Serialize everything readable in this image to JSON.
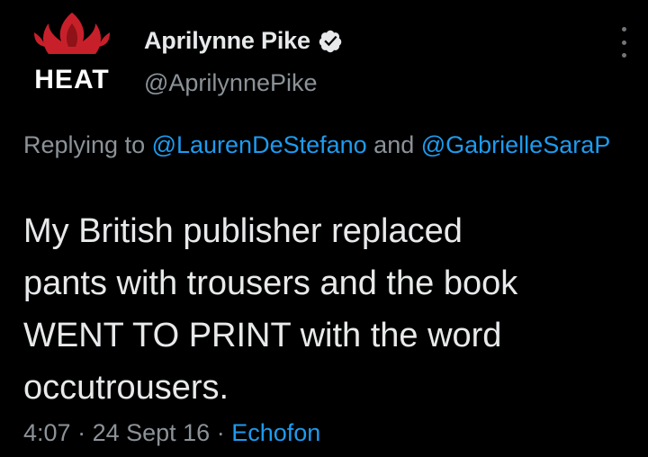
{
  "author": {
    "display_name": "Aprilynne Pike",
    "handle": "@AprilynnePike",
    "avatar_text": "HEAT",
    "verified_icon": "verified-badge-icon"
  },
  "reply": {
    "prefix": "Replying to ",
    "mention1": "@LaurenDeStefano",
    "conjunction": " and ",
    "mention2": "@GabrielleSaraP"
  },
  "tweet": {
    "text": "My British publisher replaced\npants with trousers and the book\nWENT TO PRINT with the word\noccutrousers."
  },
  "meta": {
    "time": "4:07",
    "separator1": " · ",
    "date": "24 Sept 16",
    "separator2": " · ",
    "source": "Echofon"
  },
  "colors": {
    "background": "#000000",
    "text": "#e7e9ea",
    "secondary": "#8b9298",
    "link": "#1d9bf0",
    "avatar_red": "#c8202a"
  },
  "icons": {
    "more": "more-options-icon"
  }
}
